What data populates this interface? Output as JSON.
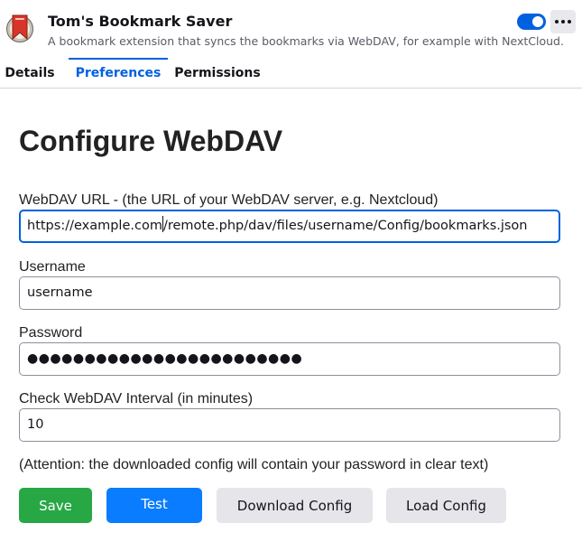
{
  "addon": {
    "name": "Tom's Bookmark Saver",
    "description": "A bookmark extension that syncs the bookmarks via WebDAV, for example with NextCloud.",
    "enabled": true,
    "logo_icon": "bookmark-logo-icon",
    "more_icon": "more-options-icon"
  },
  "tabs": [
    {
      "label": "Details",
      "active": false
    },
    {
      "label": "Preferences",
      "active": true
    },
    {
      "label": "Permissions",
      "active": false
    }
  ],
  "page": {
    "title": "Configure WebDAV"
  },
  "fields": {
    "url": {
      "label": "WebDAV URL - (the URL of your WebDAV server, e.g. Nextcloud)",
      "value_before_caret": "https://example.com",
      "value_after_caret": "/remote.php/dav/files/username/Config/bookmarks.json"
    },
    "username": {
      "label": "Username",
      "value": "username"
    },
    "password": {
      "label": "Password",
      "masked_value": "●●●●●●●●●●●●●●●●●●●●●●●●"
    },
    "interval": {
      "label": "Check WebDAV Interval (in minutes)",
      "value": "10"
    }
  },
  "attention_text": "(Attention: the downloaded config will contain your password in clear text)",
  "buttons": {
    "save": "Save",
    "test": "Test",
    "download": "Download Config",
    "load": "Load Config"
  },
  "colors": {
    "accent": "#0061e0",
    "save": "#28a745",
    "test": "#0a7cff",
    "secondary": "#e5e5ea"
  }
}
